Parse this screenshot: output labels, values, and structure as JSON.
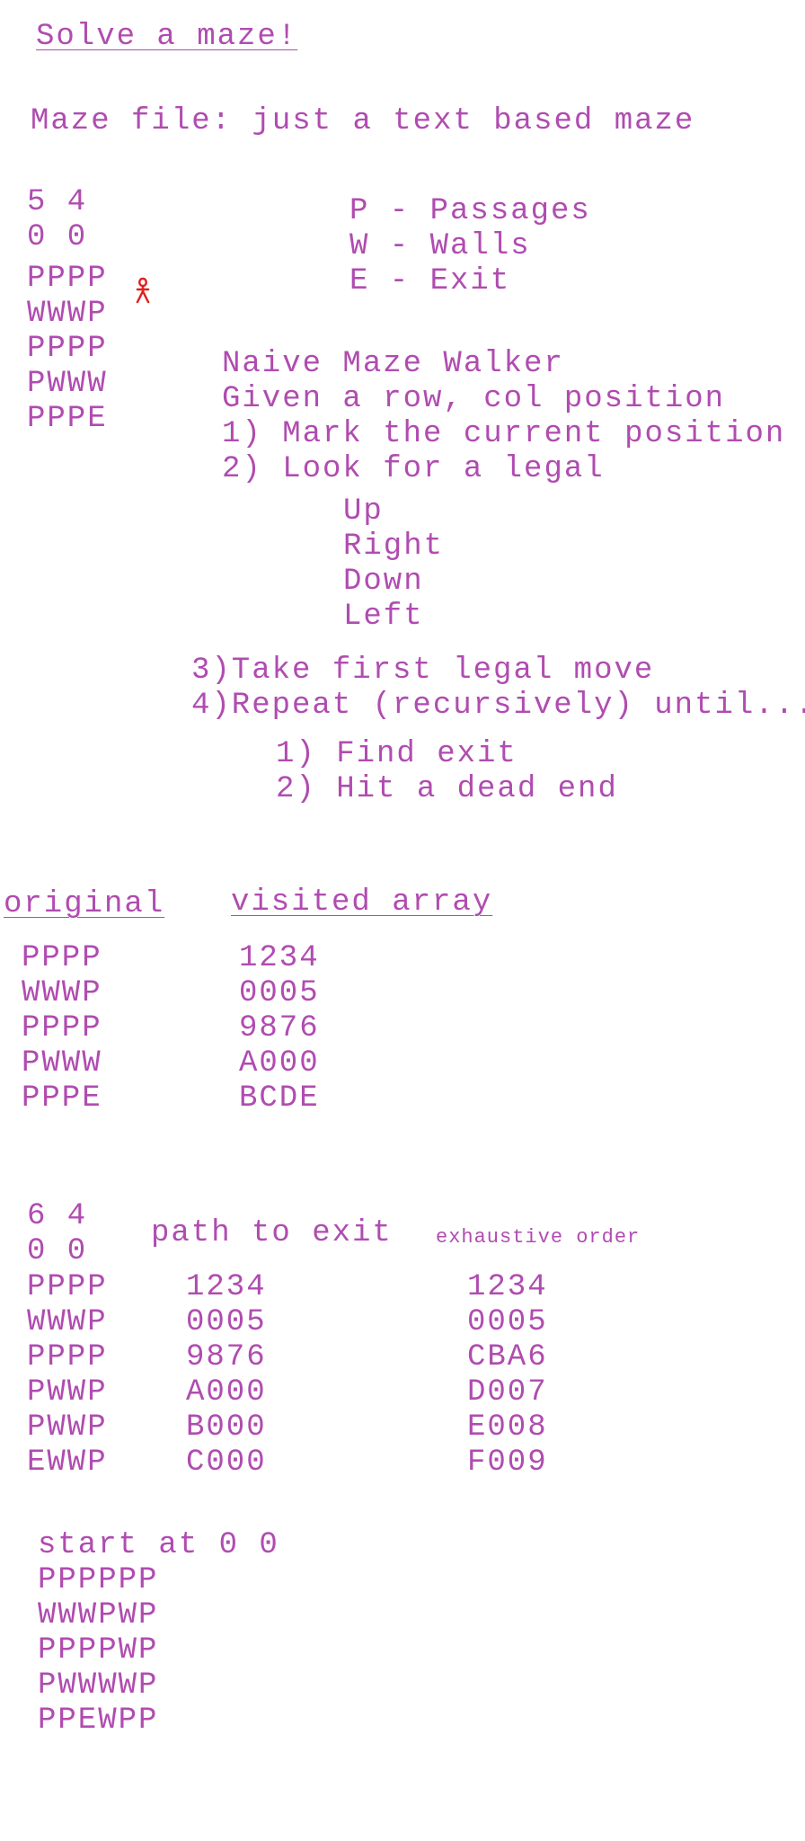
{
  "title": "Solve a maze!",
  "maze_file_line": "Maze file: just a text based maze",
  "example1": {
    "dims": "5 4",
    "start": "0 0",
    "rows": [
      "PPPP",
      "WWWP",
      "PPPP",
      "PWWW",
      "PPPE"
    ]
  },
  "legend": {
    "items": [
      "P - Passages",
      "W - Walls",
      "E - Exit"
    ]
  },
  "walker": {
    "title": "Naive Maze Walker",
    "given": "Given a row, col position",
    "step1": "1) Mark the current position",
    "step2": "2) Look for a legal",
    "directions": [
      "Up",
      "Right",
      "Down",
      "Left"
    ],
    "step3": "3)Take first legal move",
    "step4": "4)Repeat (recursively) until...",
    "until": [
      "1) Find exit",
      "2) Hit a dead end"
    ]
  },
  "comparison": {
    "original_label": "original",
    "visited_label": "visited array",
    "original_rows": [
      "PPPP",
      "WWWP",
      "PPPP",
      "PWWW",
      "PPPE"
    ],
    "visited_rows": [
      "1234",
      "0005",
      "9876",
      "A000",
      "BCDE"
    ]
  },
  "example2": {
    "dims": "6 4",
    "start": "0 0",
    "path_label": "path to exit",
    "exhaustive_label": "exhaustive order",
    "rows": [
      "PPPP",
      "WWWP",
      "PPPP",
      "PWWP",
      "PWWP",
      "EWWP"
    ],
    "path_rows": [
      "1234",
      "0005",
      "9876",
      "A000",
      "B000",
      "C000"
    ],
    "exhaustive_rows": [
      "1234",
      "0005",
      "CBA6",
      "D007",
      "E008",
      "F009"
    ]
  },
  "example3": {
    "start_label": "start at 0 0",
    "rows": [
      "PPPPPP",
      "WWWPWP",
      "PPPPWP",
      "PWWWWP",
      "PPEWPP"
    ]
  },
  "colors": {
    "ink": "#b04cb0",
    "annotation": "#e02020"
  }
}
